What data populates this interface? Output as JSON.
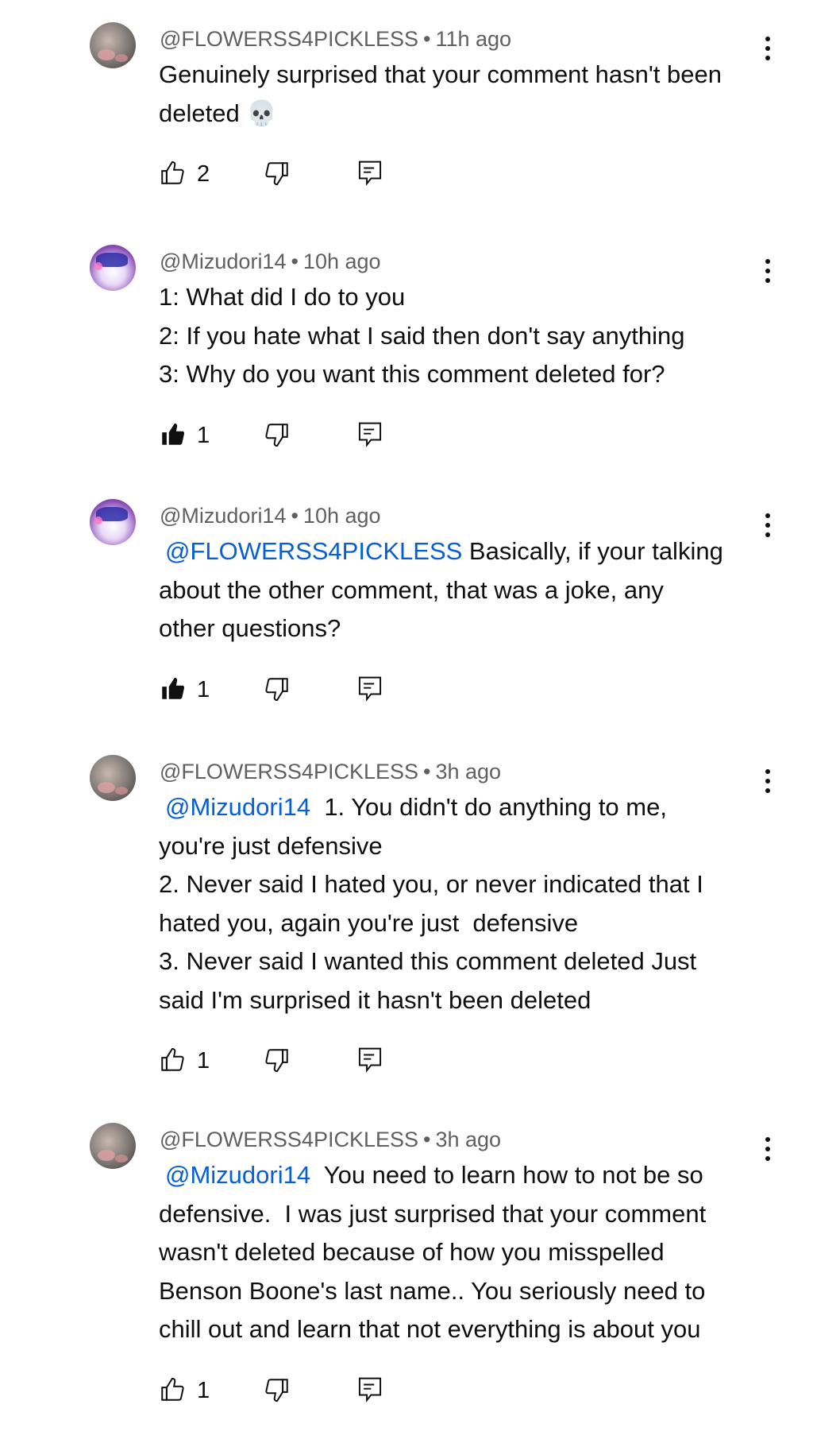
{
  "comments": [
    {
      "author": "@FLOWERSS4PICKLESS",
      "time": "11h ago",
      "avatar": "gray-avatar",
      "lines": [
        {
          "text": "Genuinely surprised that your comment hasn't been"
        },
        {
          "text": "deleted 💀"
        }
      ],
      "likes": "2",
      "liked": false
    },
    {
      "author": "@Mizudori14",
      "time": "10h ago",
      "avatar": "purple-avatar",
      "lines": [
        {
          "text": "1: What did I do to you"
        },
        {
          "text": "2: If you hate what I said then don't say anything"
        },
        {
          "text": "3: Why do you want this comment deleted for?"
        }
      ],
      "likes": "1",
      "liked": true
    },
    {
      "author": "@Mizudori14",
      "time": "10h ago",
      "avatar": "purple-avatar",
      "lines": [
        {
          "mention": "@FLOWERSS4PICKLESS",
          "text": " Basically, if your talking"
        },
        {
          "text": "about the other comment, that was a joke, any"
        },
        {
          "text": "other questions?"
        }
      ],
      "likes": "1",
      "liked": true
    },
    {
      "author": "@FLOWERSS4PICKLESS",
      "time": "3h ago",
      "avatar": "gray-avatar",
      "lines": [
        {
          "mention": "@Mizudori14",
          "text": "  1. You didn't do anything to me,"
        },
        {
          "text": "you're just defensive"
        },
        {
          "text": "2. Never said I hated you, or never indicated that I"
        },
        {
          "text": "hated you, again you're just  defensive"
        },
        {
          "text": "3. Never said I wanted this comment deleted Just"
        },
        {
          "text": "said I'm surprised it hasn't been deleted"
        }
      ],
      "likes": "1",
      "liked": false
    },
    {
      "author": "@FLOWERSS4PICKLESS",
      "time": "3h ago",
      "avatar": "gray-avatar",
      "lines": [
        {
          "mention": "@Mizudori14",
          "text": "  You need to learn how to not be so"
        },
        {
          "text": "defensive.  I was just surprised that your comment"
        },
        {
          "text": "wasn't deleted because of how you misspelled"
        },
        {
          "text": "Benson Boone's last name.. You seriously need to"
        },
        {
          "text": "chill out and learn that not everything is about you"
        }
      ],
      "likes": "1",
      "liked": false
    }
  ],
  "icons": {
    "like": "thumbs-up-icon",
    "liked": "thumbs-up-filled-icon",
    "dislike": "thumbs-down-icon",
    "reply": "reply-icon",
    "more": "more-vert-icon"
  },
  "colors": {
    "text": "#0f0f0f",
    "meta": "#606060",
    "mention": "#065fd4",
    "background": "#ffffff"
  }
}
